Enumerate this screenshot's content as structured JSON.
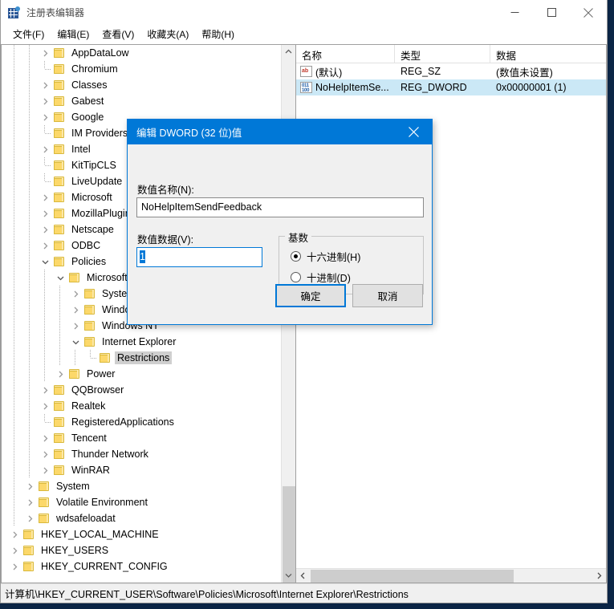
{
  "window": {
    "title": "注册表编辑器",
    "icon": "registry-icon",
    "controls": {
      "minimize": "minimize-icon",
      "maximize": "maximize-icon",
      "close": "close-icon"
    }
  },
  "menubar": {
    "items": [
      {
        "label": "文件(F)"
      },
      {
        "label": "编辑(E)"
      },
      {
        "label": "查看(V)"
      },
      {
        "label": "收藏夹(A)"
      },
      {
        "label": "帮助(H)"
      }
    ]
  },
  "tree": {
    "items": [
      {
        "label": "AppDataLow",
        "depth": 3,
        "state": "collapsed",
        "selected": false
      },
      {
        "label": "Chromium",
        "depth": 3,
        "state": "leaf",
        "selected": false
      },
      {
        "label": "Classes",
        "depth": 3,
        "state": "collapsed",
        "selected": false
      },
      {
        "label": "Gabest",
        "depth": 3,
        "state": "collapsed",
        "selected": false
      },
      {
        "label": "Google",
        "depth": 3,
        "state": "collapsed",
        "selected": false
      },
      {
        "label": "IM Providers",
        "depth": 3,
        "state": "leaf",
        "selected": false
      },
      {
        "label": "Intel",
        "depth": 3,
        "state": "collapsed",
        "selected": false
      },
      {
        "label": "KitTipCLS",
        "depth": 3,
        "state": "leaf",
        "selected": false
      },
      {
        "label": "LiveUpdate",
        "depth": 3,
        "state": "leaf",
        "selected": false
      },
      {
        "label": "Microsoft",
        "depth": 3,
        "state": "collapsed",
        "selected": false
      },
      {
        "label": "MozillaPlugins",
        "depth": 3,
        "state": "collapsed",
        "selected": false
      },
      {
        "label": "Netscape",
        "depth": 3,
        "state": "collapsed",
        "selected": false
      },
      {
        "label": "ODBC",
        "depth": 3,
        "state": "collapsed",
        "selected": false
      },
      {
        "label": "Policies",
        "depth": 3,
        "state": "expanded",
        "selected": false
      },
      {
        "label": "Microsoft",
        "depth": 4,
        "state": "expanded",
        "selected": false
      },
      {
        "label": "Systemcertificates",
        "depth": 5,
        "state": "collapsed",
        "selected": false
      },
      {
        "label": "Windows",
        "depth": 5,
        "state": "collapsed",
        "selected": false
      },
      {
        "label": "Windows NT",
        "depth": 5,
        "state": "collapsed",
        "selected": false
      },
      {
        "label": "Internet Explorer",
        "depth": 5,
        "state": "expanded",
        "selected": false
      },
      {
        "label": "Restrictions",
        "depth": 6,
        "state": "leaf",
        "selected": true
      },
      {
        "label": "Power",
        "depth": 4,
        "state": "collapsed",
        "selected": false
      },
      {
        "label": "QQBrowser",
        "depth": 3,
        "state": "collapsed",
        "selected": false
      },
      {
        "label": "Realtek",
        "depth": 3,
        "state": "collapsed",
        "selected": false
      },
      {
        "label": "RegisteredApplications",
        "depth": 3,
        "state": "leaf",
        "selected": false
      },
      {
        "label": "Tencent",
        "depth": 3,
        "state": "collapsed",
        "selected": false
      },
      {
        "label": "Thunder Network",
        "depth": 3,
        "state": "collapsed",
        "selected": false
      },
      {
        "label": "WinRAR",
        "depth": 3,
        "state": "collapsed",
        "selected": false
      },
      {
        "label": "System",
        "depth": 2,
        "state": "collapsed",
        "selected": false
      },
      {
        "label": "Volatile Environment",
        "depth": 2,
        "state": "collapsed",
        "selected": false
      },
      {
        "label": "wdsafeloadat",
        "depth": 2,
        "state": "collapsed",
        "selected": false
      },
      {
        "label": "HKEY_LOCAL_MACHINE",
        "depth": 1,
        "state": "collapsed",
        "selected": false
      },
      {
        "label": "HKEY_USERS",
        "depth": 1,
        "state": "collapsed",
        "selected": false
      },
      {
        "label": "HKEY_CURRENT_CONFIG",
        "depth": 1,
        "state": "collapsed",
        "selected": false
      }
    ]
  },
  "list": {
    "columns": [
      {
        "label": "名称"
      },
      {
        "label": "类型"
      },
      {
        "label": "数据"
      }
    ],
    "rows": [
      {
        "icon": "string-value-icon",
        "icon_text": "ab",
        "name": "(默认)",
        "type": "REG_SZ",
        "data": "(数值未设置)",
        "selected": false
      },
      {
        "icon": "dword-value-icon",
        "icon_text_1": "011",
        "icon_text_2": "100",
        "name": "NoHelpItemSe...",
        "type": "REG_DWORD",
        "data": "0x00000001 (1)",
        "selected": true
      }
    ]
  },
  "statusbar": {
    "path": "计算机\\HKEY_CURRENT_USER\\Software\\Policies\\Microsoft\\Internet Explorer\\Restrictions"
  },
  "dialog": {
    "title": "编辑 DWORD (32 位)值",
    "close_icon": "close-icon",
    "name_label": "数值名称(N):",
    "name_value": "NoHelpItemSendFeedback",
    "name_placeholder": "",
    "data_label": "数值数据(V):",
    "data_value": "1",
    "data_placeholder": "",
    "group_legend": "基数",
    "radios": [
      {
        "label": "十六进制(H)",
        "checked": true
      },
      {
        "label": "十进制(D)",
        "checked": false
      }
    ],
    "ok_label": "确定",
    "cancel_label": "取消"
  },
  "colors": {
    "accent": "#0078d7",
    "selection": "#cbe8f6",
    "tree_selection": "#cfcfcf",
    "window_chrome": "#f0f0f0",
    "desktop": "#0b2545"
  }
}
